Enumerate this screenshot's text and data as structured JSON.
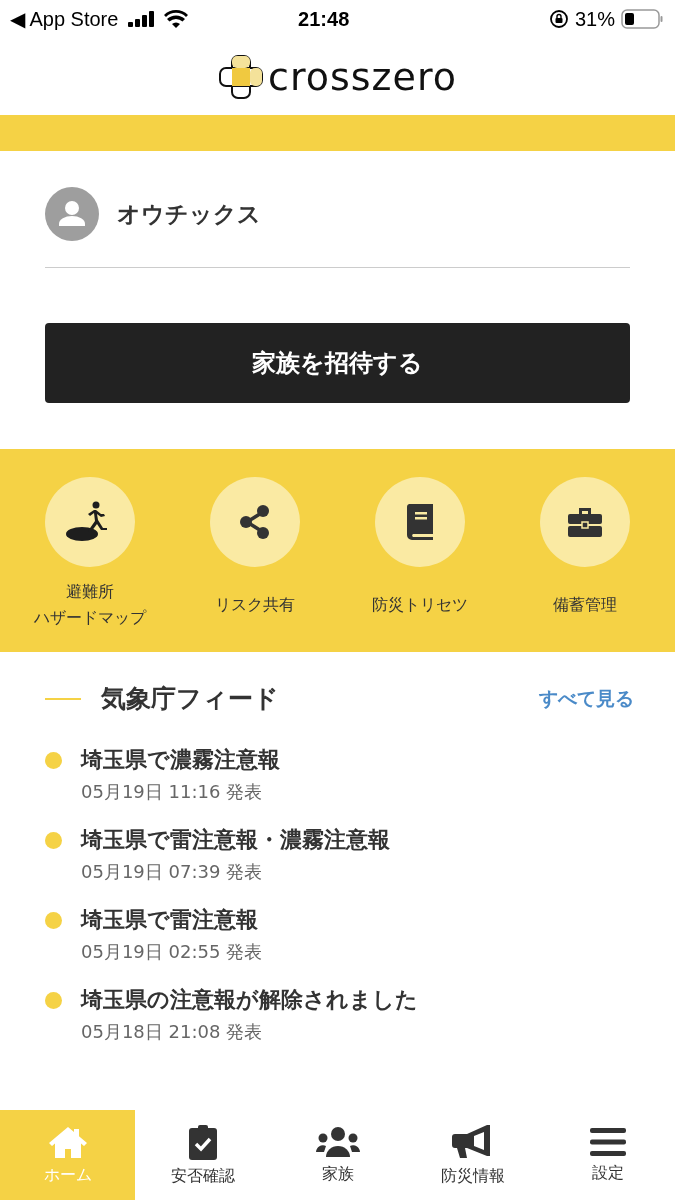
{
  "status_bar": {
    "back": "◀ App Store",
    "time": "21:48",
    "battery": "31%"
  },
  "header": {
    "logo": "crosszero"
  },
  "profile": {
    "name": "オウチックス"
  },
  "invite_button": "家族を招待する",
  "shortcuts": [
    {
      "kind": "evacuate",
      "lines": [
        "避難所",
        "ハザードマップ"
      ]
    },
    {
      "kind": "share",
      "lines": [
        "リスク共有"
      ]
    },
    {
      "kind": "book",
      "lines": [
        "防災トリセツ"
      ]
    },
    {
      "kind": "toolbox",
      "lines": [
        "備蓄管理"
      ]
    }
  ],
  "feed": {
    "title": "気象庁フィード",
    "see_all": "すべて見る",
    "items": [
      {
        "title": "埼玉県で濃霧注意報",
        "time": "05月19日 11:16 発表"
      },
      {
        "title": "埼玉県で雷注意報・濃霧注意報",
        "time": "05月19日 07:39 発表"
      },
      {
        "title": "埼玉県で雷注意報",
        "time": "05月19日 02:55 発表"
      },
      {
        "title": "埼玉県の注意報が解除されました",
        "time": "05月18日 21:08 発表"
      }
    ]
  },
  "tabs": [
    {
      "kind": "home",
      "label": "ホーム",
      "selected": true
    },
    {
      "kind": "check",
      "label": "安否確認",
      "selected": false
    },
    {
      "kind": "family",
      "label": "家族",
      "selected": false
    },
    {
      "kind": "megaphone",
      "label": "防災情報",
      "selected": false
    },
    {
      "kind": "menu",
      "label": "設定",
      "selected": false
    }
  ]
}
